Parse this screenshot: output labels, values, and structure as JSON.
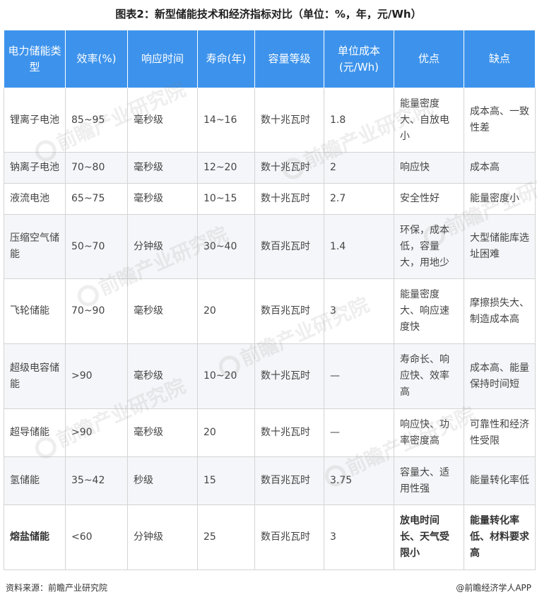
{
  "title": "图表2：新型储能技术和经济指标对比（单位：%，年，元/Wh）",
  "headers": [
    "电力储能类型",
    "效率(%)",
    "响应时间",
    "寿命(年)",
    "容量等级",
    "单位成本(元/Wh)",
    "优点",
    "缺点"
  ],
  "rows": [
    [
      "锂离子电池",
      "85~95",
      "毫秒级",
      "14~16",
      "数十兆瓦时",
      "1.8",
      "能量密度大、自放电小",
      "成本高、一致性差"
    ],
    [
      "钠离子电池",
      "70~80",
      "毫秒级",
      "12~20",
      "数十兆瓦时",
      "2",
      "响应快",
      "成本高"
    ],
    [
      "液流电池",
      "65~75",
      "毫秒级",
      "10~15",
      "数十兆瓦时",
      "2.7",
      "安全性好",
      "能量密度小"
    ],
    [
      "压缩空气储能",
      "50~70",
      "分钟级",
      "30~40",
      "数百兆瓦时",
      "1.4",
      "环保，成本低，容量大，用地少",
      "大型储能库选址困难"
    ],
    [
      "飞轮储能",
      "70~90",
      "毫秒级",
      "20",
      "数百兆瓦时",
      "3",
      "能量密度大、响应速度快",
      "摩擦损失大、制造成本高"
    ],
    [
      "超级电容储能",
      ">90",
      "毫秒级",
      "10~20",
      "数十兆瓦时",
      "—",
      "寿命长、响应快、效率高",
      "成本高、能量保持时间短"
    ],
    [
      "超导储能",
      ">90",
      "毫秒级",
      "20",
      "数十兆瓦时",
      "—",
      "响应快、功率密度高",
      "可靠性和经济性受限"
    ],
    [
      "氢储能",
      "35~42",
      "秒级",
      "15",
      "数百兆瓦时",
      "3.75",
      "容量大、适用性强",
      "能量转化率低"
    ],
    [
      "熔盐储能",
      "<60",
      "分钟级",
      "25",
      "数百兆瓦时",
      "3",
      "放电时间长、天气受限小",
      "能量转化率低、材料要求高"
    ]
  ],
  "watermark": "前瞻产业研究院",
  "footer": {
    "source": "资料来源：前瞻产业研究院",
    "brand": "@前瞻经济学人APP"
  }
}
